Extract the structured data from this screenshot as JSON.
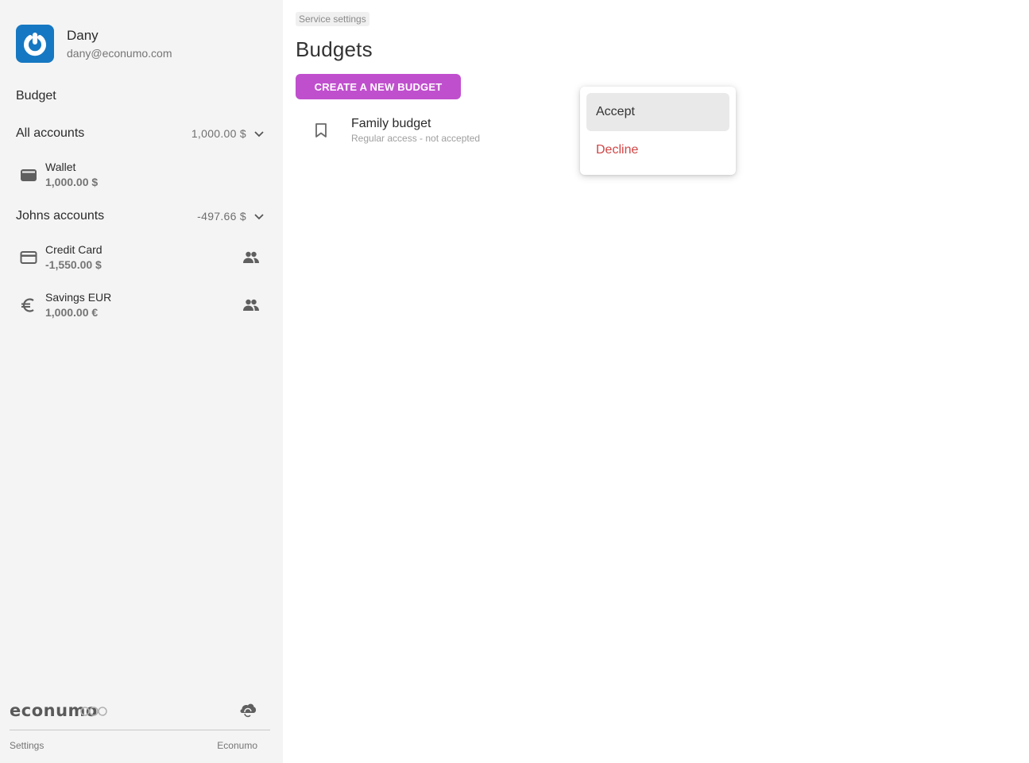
{
  "user": {
    "name": "Dany",
    "email": "dany@econumo.com"
  },
  "sidebar": {
    "budget_label": "Budget",
    "groups": [
      {
        "title": "All accounts",
        "total": "1,000.00 $",
        "accounts": [
          {
            "name": "Wallet",
            "balance": "1,000.00 $",
            "icon": "wallet-icon",
            "shared": false
          }
        ]
      },
      {
        "title": "Johns accounts",
        "total": "-497.66 $",
        "accounts": [
          {
            "name": "Credit Card",
            "balance": "-1,550.00 $",
            "icon": "credit-card-icon",
            "shared": true
          },
          {
            "name": "Savings EUR",
            "balance": "1,000.00 €",
            "icon": "euro-icon",
            "shared": true
          }
        ]
      }
    ],
    "footer": {
      "logo_text": "econumo",
      "settings_label": "Settings",
      "econumo_label": "Econumo"
    }
  },
  "main": {
    "breadcrumb": "Service settings",
    "title": "Budgets",
    "create_button": "CREATE A NEW BUDGET",
    "budgets": [
      {
        "name": "Family budget",
        "subtitle": "Regular access - not accepted"
      }
    ]
  },
  "context_menu": {
    "items": [
      {
        "label": "Accept",
        "state": "hover"
      },
      {
        "label": "Decline",
        "color": "#d14545"
      }
    ]
  },
  "colors": {
    "accent": "#c04fce",
    "avatar_bg": "#1678c2",
    "danger": "#d14545",
    "sidebar_bg": "#f4f4f4"
  }
}
